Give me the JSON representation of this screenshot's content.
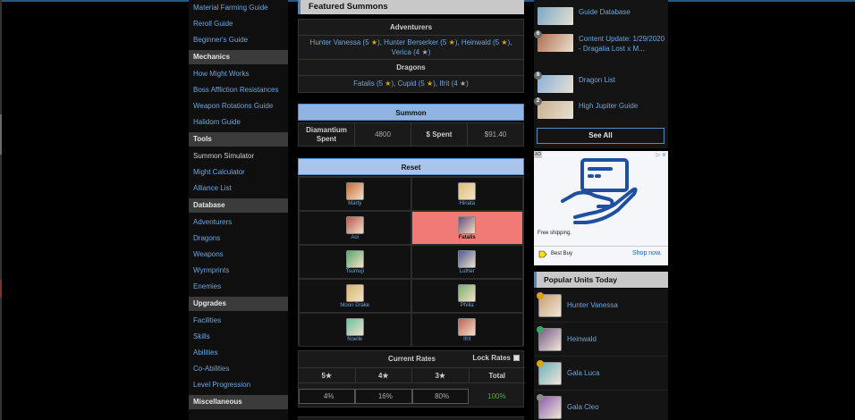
{
  "sidebar": {
    "top_items": [
      "Material Farming Guide",
      "Reroll Guide",
      "Beginner's Guide"
    ],
    "sections": [
      {
        "title": "Mechanics",
        "items": [
          "How Might Works",
          "Boss Affliction Resistances",
          "Weapon Rotations Guide",
          "Halidom Guide"
        ]
      },
      {
        "title": "Tools",
        "items": [
          "Summon Simulator",
          "Might Calculator",
          "Alliance List"
        ]
      },
      {
        "title": "Database",
        "items": [
          "Adventurers",
          "Dragons",
          "Weapons",
          "Wyrmprints",
          "Enemies"
        ]
      },
      {
        "title": "Upgrades",
        "items": [
          "Facilities",
          "Skills",
          "Abilities",
          "Co-Abilities",
          "Level Progression"
        ]
      },
      {
        "title": "Miscellaneous",
        "items": []
      }
    ]
  },
  "featured": {
    "title": "Featured Summons",
    "adventurers_label": "Adventurers",
    "adventurers_text": [
      "Hunter Vanessa (5 ",
      "), Hunter Berserker (5 ",
      "), Heinwald (5 ",
      "), Verica (4 ",
      ")"
    ],
    "dragons_label": "Dragons",
    "dragons_text": [
      "Fatalis (5 ",
      "), Cupid (5 ",
      "), Ifrit (4 ",
      ")"
    ],
    "star_glyph": "★"
  },
  "summon": {
    "button_label": "Summon",
    "diamantium_label": "Diamantium Spent",
    "diamantium_value": "4800",
    "dollar_label": "$ Spent",
    "dollar_value": "$91.40"
  },
  "reset": {
    "button_label": "Reset",
    "units": [
      {
        "name": "Marty",
        "color": "#c86a3a",
        "highlight": false
      },
      {
        "name": "Hinata",
        "color": "#e0c070",
        "highlight": false
      },
      {
        "name": "Aoi",
        "color": "#b8584e",
        "highlight": false
      },
      {
        "name": "Fatalis",
        "color": "#6b4a78",
        "highlight": true
      },
      {
        "name": "Tsumuji",
        "color": "#5aa86a",
        "highlight": false
      },
      {
        "name": "Luther",
        "color": "#4a5a9a",
        "highlight": false
      },
      {
        "name": "Moon Drake",
        "color": "#d6b66a",
        "highlight": false
      },
      {
        "name": "Philia",
        "color": "#7ab068",
        "highlight": false
      },
      {
        "name": "Noelle",
        "color": "#6ac0a0",
        "highlight": false
      },
      {
        "name": "Ifrit",
        "color": "#c0605a",
        "highlight": false
      }
    ]
  },
  "rates": {
    "title": "Current Rates",
    "lock_label": "Lock Rates",
    "headers": [
      "5★",
      "4★",
      "3★",
      "Total"
    ],
    "values": [
      "4%",
      "16%",
      "80%"
    ],
    "total": "100%"
  },
  "news": {
    "items": [
      {
        "num": "",
        "text": "Guide Database",
        "color": "#7aa8c8"
      },
      {
        "num": "6",
        "text": "Content Update: 1/29/2020 - Dragalia Lost x M...",
        "color": "#b07050"
      },
      {
        "num": "8",
        "text": "Dragon List",
        "color": "#8ab0d8"
      },
      {
        "num": "2",
        "text": "High Jupiter Guide",
        "color": "#c8b090"
      }
    ],
    "see_all": "See All"
  },
  "ad": {
    "shipping": "Free shipping.",
    "store": "Best Buy",
    "shop_now": "Shop now.",
    "ad_choices": "AD",
    "close": "▷ ✕"
  },
  "popular": {
    "title": "Popular Units Today",
    "units": [
      {
        "name": "Hunter Vanessa",
        "color": "#c8a070",
        "element": "#d6a31a"
      },
      {
        "name": "Heinwald",
        "color": "#7a5a8a",
        "element": "#3fa36a"
      },
      {
        "name": "Gala Luca",
        "color": "#6ab0c0",
        "element": "#d6a31a"
      },
      {
        "name": "Gala Cleo",
        "color": "#8a5ab0",
        "element": "#8a8a8a"
      }
    ]
  },
  "colors": {
    "link": "#6aa6e0",
    "summon_bar": "#8db4e2",
    "reset_bar": "#a9c3ea",
    "highlight_cell": "#f17b74",
    "total_green": "#3fb33f"
  }
}
